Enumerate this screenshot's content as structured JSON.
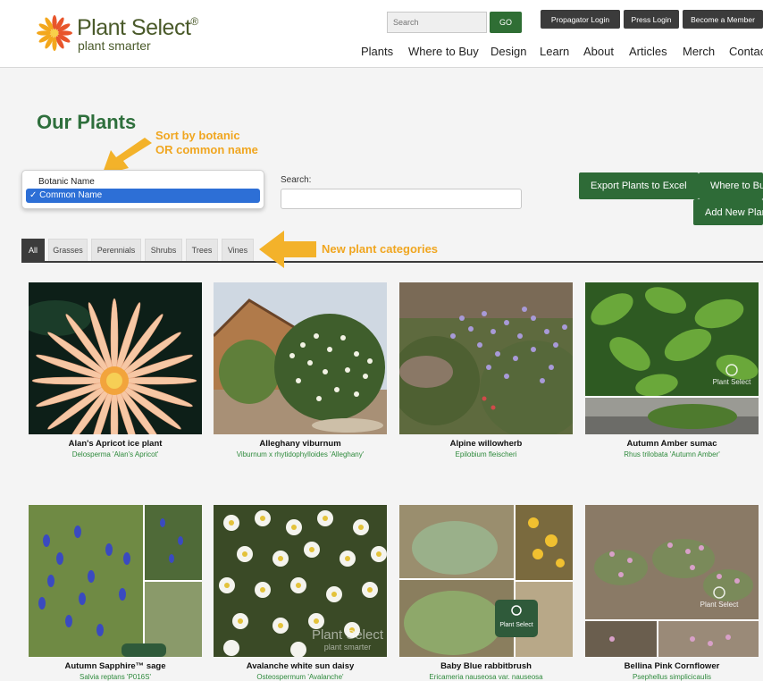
{
  "brand": {
    "title": "Plant Select",
    "reg": "®",
    "tagline": "plant smarter"
  },
  "header": {
    "search_placeholder": "Search",
    "go_label": "GO",
    "top_buttons": [
      "Propagator Login",
      "Press Login",
      "Become a Member"
    ],
    "nav": [
      "Plants",
      "Where to Buy",
      "Design",
      "Learn",
      "About",
      "Articles",
      "Merch",
      "Contac"
    ]
  },
  "main": {
    "title": "Our Plants",
    "annotation_sort": [
      "Sort by botanic",
      "OR common name"
    ],
    "annotation_categories": "New plant categories",
    "sort_options": [
      "Botanic Name",
      "Common Name"
    ],
    "sort_selected_mark": "✓",
    "search_label": "Search:",
    "buttons": {
      "export": "Export Plants to Excel",
      "where_to_buy": "Where to Bu",
      "add_new": "Add New Plan"
    },
    "tabs": [
      "All",
      "Grasses",
      "Perennials",
      "Shrubs",
      "Trees",
      "Vines"
    ],
    "active_tab": "All"
  },
  "plants": [
    {
      "name": "Alan's Apricot ice plant",
      "botanic": "Delosperma 'Alan's Apricot'"
    },
    {
      "name": "Alleghany viburnum",
      "botanic": "Viburnum x rhytidophylloides 'Alleghany'"
    },
    {
      "name": "Alpine willowherb",
      "botanic": "Epilobium fleischeri"
    },
    {
      "name": "Autumn Amber sumac",
      "botanic": "Rhus trilobata 'Autumn Amber'"
    },
    {
      "name": "Autumn Sapphire™ sage",
      "botanic": "Salvia reptans 'P016S'"
    },
    {
      "name": "Avalanche white sun daisy",
      "botanic": "Osteospermum 'Avalanche'"
    },
    {
      "name": "Baby Blue rabbitbrush",
      "botanic": "Ericameria nauseosa var. nauseosa"
    },
    {
      "name": "Bellina Pink Cornflower",
      "botanic": "Psephellus simplicicaulis"
    }
  ],
  "watermarks": {
    "mark": "Plant Select",
    "sub": "plant smarter"
  },
  "colors": {
    "brand_green": "#2e6b37",
    "annotation": "#f0a620",
    "dark_button": "#3b3b3b",
    "selection_blue": "#2d6fd6"
  }
}
